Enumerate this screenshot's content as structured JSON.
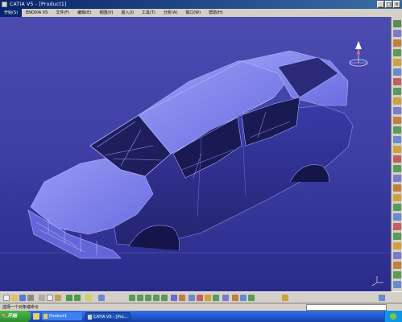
{
  "window": {
    "title": "CATIA V5 - [Product1]"
  },
  "menu": {
    "items": [
      "开始(S)",
      "ENOVIA V5",
      "文件(F)",
      "编辑(E)",
      "视图(V)",
      "插入(I)",
      "工具(T)",
      "分析(A)",
      "窗口(W)",
      "帮助(H)"
    ],
    "active_index": 0
  },
  "viewport": {
    "model": "car body-in-white",
    "background_top": "#4b4bb0",
    "background_bottom": "#2b2b8a",
    "model_color": "#8d8ff0",
    "compass_icon": "compass-icon"
  },
  "status": {
    "prompt": "选择一个对象或命令"
  },
  "taskbar": {
    "start_label": "开始",
    "tasks": [
      {
        "label": "Product1",
        "icon": "folder-icon"
      },
      {
        "label": "CATIA V5 - [Pro...",
        "icon": "catia-icon"
      }
    ]
  },
  "toolbar_icons": {
    "right": [
      "icon-1",
      "icon-2",
      "icon-3",
      "icon-4",
      "icon-5",
      "icon-6",
      "icon-7",
      "icon-8",
      "icon-9",
      "icon-10",
      "icon-11",
      "icon-12",
      "icon-13",
      "icon-14",
      "icon-15",
      "icon-16",
      "icon-17",
      "icon-18",
      "icon-19",
      "icon-20",
      "icon-21",
      "icon-22",
      "icon-23",
      "icon-24",
      "icon-25",
      "icon-26",
      "icon-27",
      "icon-28",
      "icon-29",
      "icon-30"
    ],
    "bottom": [
      "new-icon",
      "open-icon",
      "save-icon",
      "print-icon",
      "cut-icon",
      "copy-icon",
      "paste-icon",
      "undo-icon",
      "redo-icon",
      "whats-this-icon",
      "fly-icon",
      "fit-all-icon",
      "pan-icon",
      "rotate-icon",
      "zoom-in-icon",
      "zoom-out-icon",
      "normal-view-icon",
      "multi-view-icon",
      "iso-view-icon",
      "render-style-icon",
      "hide-show-icon",
      "swap-visible-icon",
      "sheet-icon",
      "material-icon",
      "measure-icon",
      "apply-icon",
      "catalog-icon",
      "compass-toggle-icon"
    ]
  }
}
